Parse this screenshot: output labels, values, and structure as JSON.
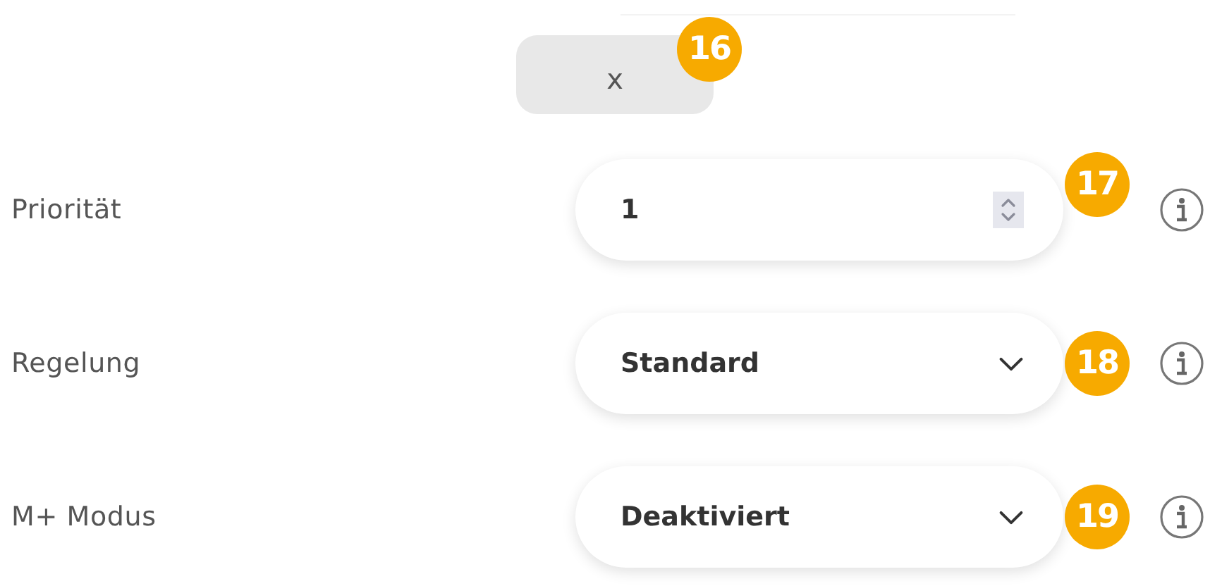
{
  "close_button": {
    "label": "x",
    "badge": "16"
  },
  "settings": [
    {
      "kind": "number",
      "label": "Priorität",
      "value": "1",
      "badge": "17"
    },
    {
      "kind": "select",
      "label": "Regelung",
      "value": "Standard",
      "badge": "18"
    },
    {
      "kind": "select",
      "label": "M+ Modus",
      "value": "Deaktiviert",
      "badge": "19"
    }
  ]
}
